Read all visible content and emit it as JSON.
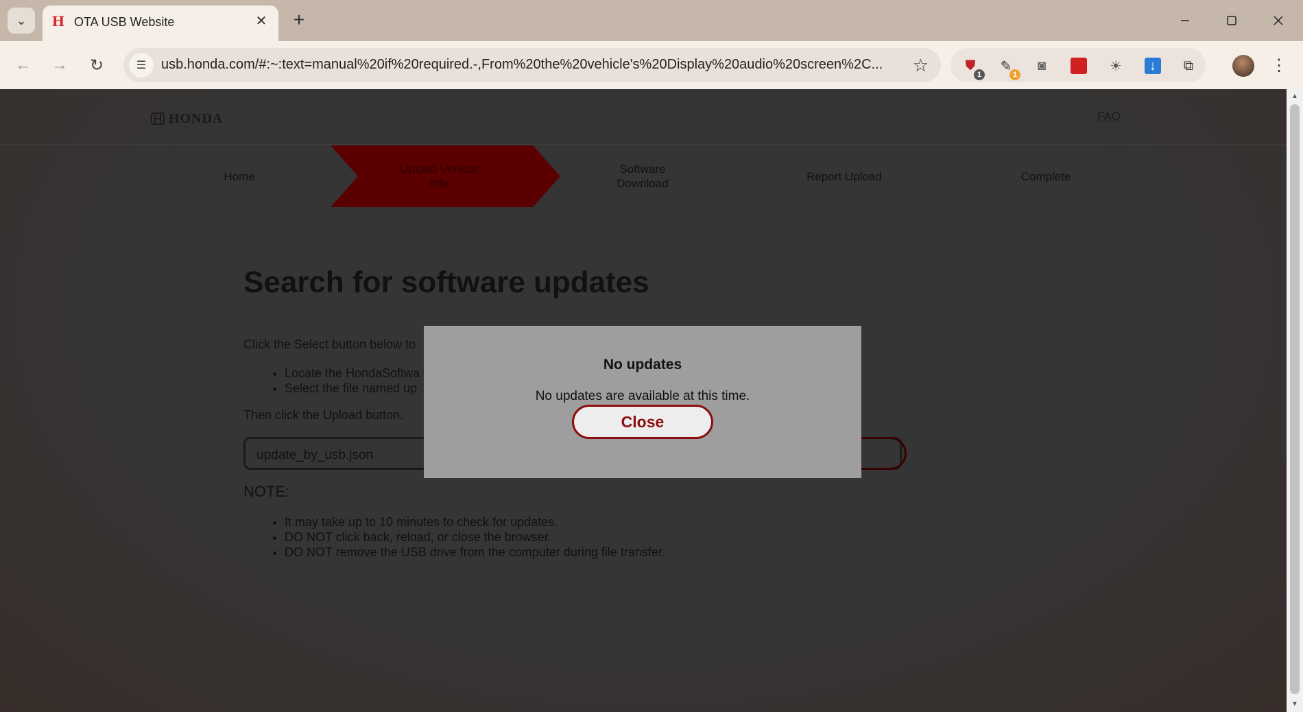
{
  "browser": {
    "tab_title": "OTA USB Website",
    "tab_favicon": "H",
    "url": "usb.honda.com/#:~:text=manual%20if%20required.-,From%20the%20vehicle's%20Display%20audio%20screen%2C...",
    "extensions": [
      {
        "icon": "shield-icon",
        "badge": "1",
        "color": "#c2202a"
      },
      {
        "icon": "pen-icon",
        "badge": "1",
        "color": "#f0a030"
      },
      {
        "icon": "glasses-icon",
        "badge": "",
        "color": "#666666"
      },
      {
        "icon": "red-square-icon",
        "badge": "",
        "color": "#d22020"
      },
      {
        "icon": "sun-icon",
        "badge": "",
        "color": "#555555"
      },
      {
        "icon": "download-icon",
        "badge": "",
        "color": "#2a7bd6"
      },
      {
        "icon": "puzzle-icon",
        "badge": "",
        "color": "#333333"
      }
    ]
  },
  "header": {
    "logo_text": "HONDA",
    "faq_label": "FAQ"
  },
  "steps": [
    {
      "label": "Home",
      "active": false
    },
    {
      "label": "Upload Vehicle Info",
      "active": true
    },
    {
      "label": "Software Download",
      "active": false
    },
    {
      "label": "Report Upload",
      "active": false
    },
    {
      "label": "Complete",
      "active": false
    }
  ],
  "main": {
    "title": "Search for software updates",
    "instruction": "Click the Select button below to",
    "bullets": [
      "Locate the HondaSoftwa",
      "Select the file named up"
    ],
    "then_text": "Then click the Upload button.",
    "file_name": "update_by_usb.json",
    "note_title": "NOTE:",
    "notes": [
      "It may take up to 10 minutes to check for updates.",
      "DO NOT click back, reload, or close the browser.",
      "DO NOT remove the USB drive from the computer during file transfer."
    ]
  },
  "modal": {
    "title": "No updates",
    "message": "No updates are available at this time.",
    "close_label": "Close"
  },
  "colors": {
    "brand_red": "#8b0d0d",
    "active_step": "#5a0000"
  }
}
